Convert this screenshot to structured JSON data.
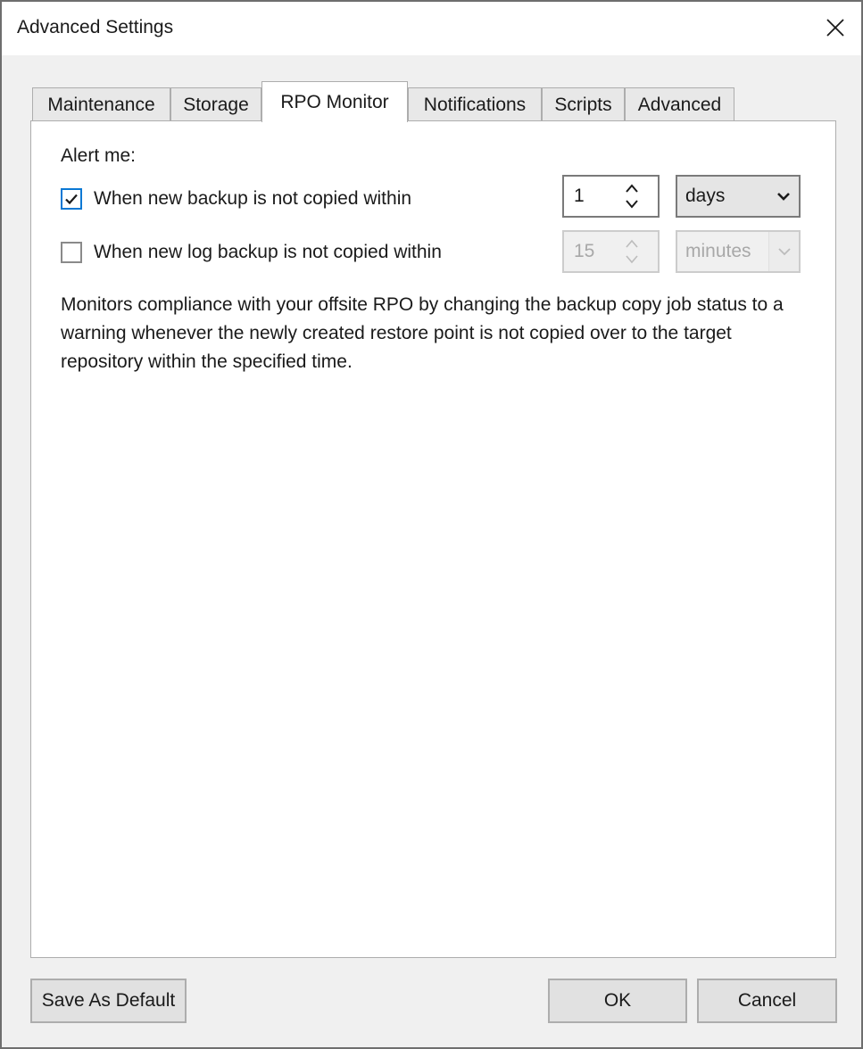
{
  "window": {
    "title": "Advanced Settings",
    "close_icon": "close-icon"
  },
  "tabs": [
    {
      "label": "Maintenance",
      "active": false
    },
    {
      "label": "Storage",
      "active": false
    },
    {
      "label": "RPO Monitor",
      "active": true
    },
    {
      "label": "Notifications",
      "active": false
    },
    {
      "label": "Scripts",
      "active": false
    },
    {
      "label": "Advanced",
      "active": false
    }
  ],
  "rpo_monitor": {
    "alert_label": "Alert me:",
    "backup_alert": {
      "label": "When new backup is not copied within",
      "checked": true,
      "value": "1",
      "unit": "days",
      "enabled": true
    },
    "log_backup_alert": {
      "label": "When new log backup is not copied within",
      "checked": false,
      "value": "15",
      "unit": "minutes",
      "enabled": false
    },
    "description": "Monitors compliance with your offsite RPO by changing the backup copy job status to a warning whenever the newly created restore point is not copied over to the target repository within the specified time."
  },
  "buttons": {
    "save_default": "Save As Default",
    "ok": "OK",
    "cancel": "Cancel"
  },
  "colors": {
    "checkbox_accent": "#0a78d4",
    "disabled_text": "#a8a8a8"
  }
}
